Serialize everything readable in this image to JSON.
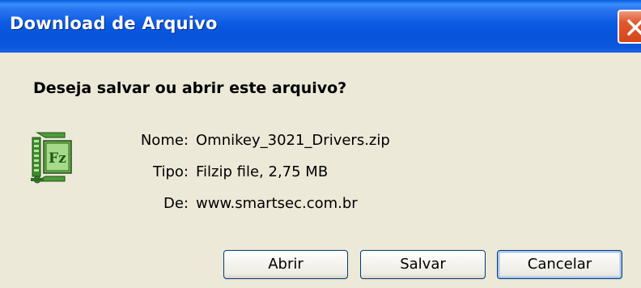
{
  "window": {
    "title": "Download de Arquivo",
    "close_icon": "close-icon",
    "title_bar_color": "#0A56DC",
    "close_button_color": "#E2582C"
  },
  "dialog": {
    "question": "Deseja salvar ou abrir este arquivo?",
    "file_icon": "filzip-archive-icon",
    "fields": [
      {
        "label": "Nome:",
        "value": "Omnikey_3021_Drivers.zip"
      },
      {
        "label": "Tipo:",
        "value": "Filzip file, 2,75 MB"
      },
      {
        "label": "De:",
        "value": "www.smartsec.com.br"
      }
    ]
  },
  "buttons": {
    "open_label": "Abrir",
    "save_label": "Salvar",
    "cancel_label": "Cancelar"
  }
}
